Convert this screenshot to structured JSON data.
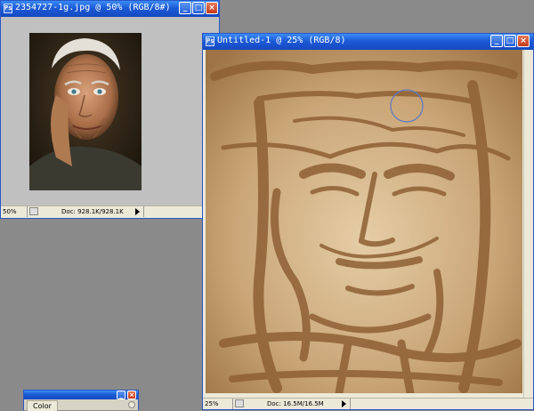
{
  "windows": {
    "photo": {
      "title": "2354727-1g.jpg @ 50% (RGB/8#)",
      "zoom": "50%",
      "doc_size": "Doc: 928.1K/928.1K"
    },
    "sketch": {
      "title": "Untitled-1 @ 25% (RGB/8)",
      "zoom": "25%",
      "doc_size": "Doc: 16.5M/16.5M"
    },
    "color_panel": {
      "tab_label": "Color"
    }
  },
  "title_buttons": {
    "minimize": "_",
    "maximize": "□",
    "close": "×"
  },
  "icons": {
    "document_icon": "ps-document-icon",
    "brush_cursor": "brush-cursor-circle-icon"
  },
  "colors": {
    "desktop": "#8a8a8a",
    "title_bar": "#1c5ad6",
    "sepia": "#a9804f",
    "close": "#c33a17"
  }
}
